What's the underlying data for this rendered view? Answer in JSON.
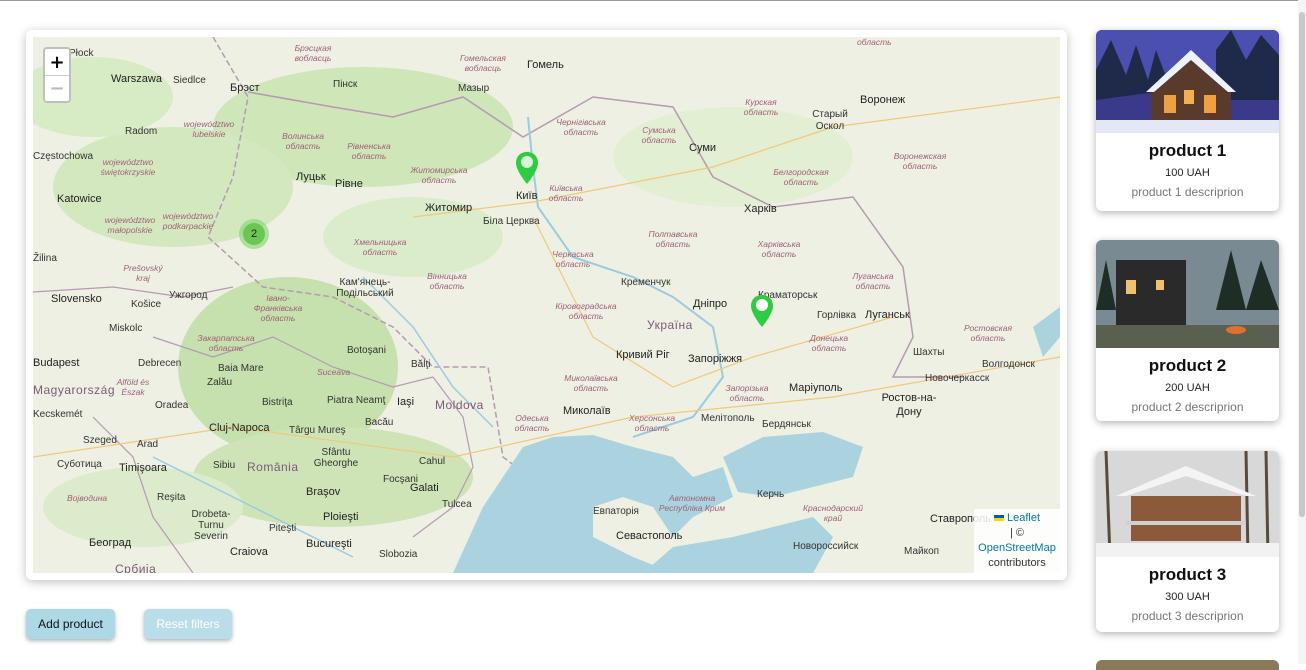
{
  "map": {
    "zoom_in_label": "+",
    "zoom_out_label": "−",
    "cluster_count": "2",
    "attribution": {
      "leaflet": "Leaflet",
      "separator": "| ©",
      "osm": "OpenStreetMap",
      "contributors": "contributors"
    },
    "labels": {
      "warszawa": "Warszawa",
      "siedlce": "Siedlce",
      "brest": "Брэст",
      "pinsk": "Пінск",
      "mazyr": "Мазыр",
      "homel": "Гомель",
      "voronezh": "Воронеж",
      "staryi_oskol": "Старый Оскол",
      "radom": "Radom",
      "czestochowa": "Częstochowa",
      "katowice": "Katowice",
      "lutsk": "Луцьк",
      "rivne": "Рівне",
      "zhytomyr": "Житомир",
      "kyiv": "Київ",
      "bila_tserkva": "Біла Церква",
      "sumy": "Суми",
      "kharkiv": "Харків",
      "slovensko": "Slovensko",
      "kosice": "Košice",
      "uzhhorod": "Ужгород",
      "kamianets": "Кам'янець-Подільський",
      "kremenchuk": "Кременчук",
      "dnipro": "Дніпро",
      "kramatorsk": "Краматорськ",
      "horlivka": "Горлівка",
      "luhansk": "Луганськ",
      "ukraina": "Україна",
      "miskolc": "Miskolc",
      "kryvyi_rih": "Кривий Ріг",
      "zaporizhzhia": "Запоріжжя",
      "shakhty": "Шахты",
      "volgodonsk": "Волгодонск",
      "budapest": "Budapest",
      "debrecen": "Debrecen",
      "baia_mare": "Baia Mare",
      "botosani": "Botoşani",
      "balti": "Bălţi",
      "novocherkassk": "Новочеркасск",
      "magyarorszag": "Magyarország",
      "zalau": "Zalău",
      "mariupol": "Маріуполь",
      "kecskemet": "Kecskemét",
      "oradea": "Oradea",
      "bistrita": "Bistriţa",
      "piatra_neamt": "Piatra Neamţ",
      "iasi": "Iaşi",
      "moldova": "Moldova",
      "mykolaiv": "Миколаїв",
      "melitopol": "Мелітополь",
      "rostov": "Ростов-на-Дону",
      "szeged": "Szeged",
      "cluj": "Cluj-Napoca",
      "targu_mures": "Târgu Mureş",
      "bacau": "Bacău",
      "berdiansk": "Бердянськ",
      "subotica": "Суботица",
      "timisoara": "Timişoara",
      "arad": "Arad",
      "sibiu": "Sibiu",
      "romania": "România",
      "gheorghe": "Sfântu Gheorghe",
      "cahul": "Cahul",
      "resita": "Reşita",
      "brasov": "Braşov",
      "focsani": "Focşani",
      "galati": "Galati",
      "tulcea": "Tulcea",
      "yevpatoria": "Евпаторія",
      "kerch": "Керчь",
      "stavropol": "Ставрополь",
      "drobeta": "Drobeta-Turnu Severin",
      "pitesti": "Piteşti",
      "ploiesti": "Ploieşti",
      "beograd": "Београд",
      "craiova": "Craiova",
      "bucuresti": "Bucureşti",
      "slobozia": "Slobozia",
      "sevastopol": "Севастополь",
      "novorossiysk": "Новороссийск",
      "maikop": "Майкоп",
      "srbija": "Србија",
      "block": "Płock",
      "lina": "Žilina",
      "reg_brest": "Брэсцкая вобласць",
      "reg_homel": "Гомельская вобласць",
      "reg_lub": "województwo lubelskie",
      "reg_swie": "województwo świętokrzyskie",
      "reg_mal": "województwo małopolskie",
      "reg_podk": "województwo podkarpackie",
      "reg_volyn": "Волинська область",
      "reg_rivne": "Рівненська область",
      "reg_zhyt": "Житомирська область",
      "reg_cherni": "Чернігівська область",
      "reg_sumy": "Сумська область",
      "reg_kursk": "Курская область",
      "reg_belg": "Белгородская область",
      "reg_voron": "Воронежская область",
      "reg_kyivobl": "Київська область",
      "reg_khmel": "Хмельницька область",
      "reg_vinn": "Вінницька область",
      "reg_cherk": "Черкаська область",
      "reg_poltava": "Полтавська область",
      "reg_kharkiv": "Харківська область",
      "reg_luhansk": "Луганська область",
      "reg_presov": "Prešovský kraj",
      "reg_ivano": "Івано-Франківська область",
      "reg_zakarp": "Закарпатська область",
      "reg_kirov": "Кіровоградська область",
      "reg_donetsk": "Донецька область",
      "reg_rostov": "Ростовская область",
      "reg_suceava": "Suceava",
      "reg_mykol": "Миколаївська область",
      "reg_zapor": "Запорізька область",
      "reg_odesa": "Одеська область",
      "reg_kherson": "Херсонська область",
      "reg_krym": "Автономна Республіка Крим",
      "reg_krasnodar": "Краснодарский край",
      "reg_alfold": "Alföld és Észak",
      "reg_vojvodina": "Војводина",
      "reg_oblast": "область"
    }
  },
  "actions": {
    "add_product": "Add product",
    "reset_filters": "Reset filters"
  },
  "products": [
    {
      "name": "product 1",
      "price": "100 UAH",
      "description": "product 1 descriprion"
    },
    {
      "name": "product 2",
      "price": "200 UAH",
      "description": "product 2 descriprion"
    },
    {
      "name": "product 3",
      "price": "300 UAH",
      "description": "product 3 descriprion"
    }
  ],
  "colors": {
    "marker": "#2ecc40",
    "cluster": "#5fc346",
    "button_primary": "#add8e6",
    "sea": "#aad3df"
  },
  "icons": {
    "marker": "map-marker-icon",
    "flag": "ukraine-flag-icon"
  }
}
